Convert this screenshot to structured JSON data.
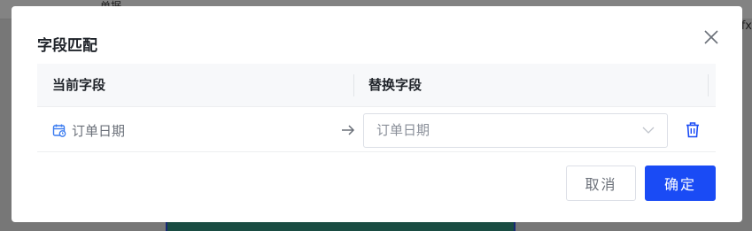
{
  "background": {
    "tabs": [
      "单据"
    ],
    "right_text": "fx"
  },
  "dialog": {
    "title": "字段匹配",
    "table": {
      "columns": [
        "当前字段",
        "替换字段"
      ],
      "rows": [
        {
          "current_field": "订单日期",
          "current_field_icon": "calendar-icon",
          "replace_field": "订单日期"
        }
      ]
    },
    "cancel_label": "取消",
    "ok_label": "确定"
  },
  "colors": {
    "primary": "#1a4bf5",
    "icon_blue": "#3b7cf0"
  }
}
